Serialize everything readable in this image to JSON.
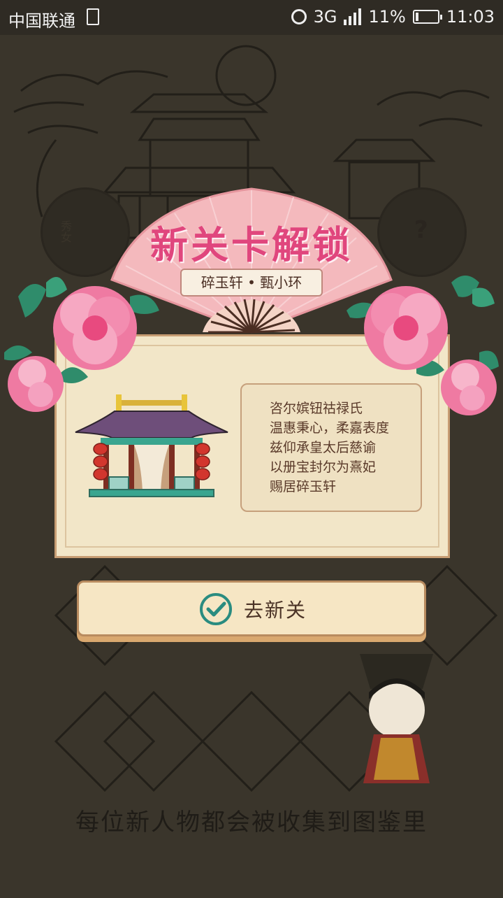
{
  "status_bar": {
    "carrier": "中国联通",
    "network": "3G",
    "battery": "11%",
    "time": "11:03"
  },
  "background": {
    "left_badge": "秀女",
    "right_badge": "?",
    "caption": "每位新人物都会被收集到图鉴里"
  },
  "popup": {
    "title": "新关卡解锁",
    "subtitle": "碎玉轩 • 甄小环",
    "decree_lines": [
      "咨尔嫔钮祜禄氏",
      "温惠秉心，柔嘉表度",
      "兹仰承皇太后慈谕",
      "以册宝封尔为熹妃",
      "赐居碎玉轩"
    ],
    "button_label": "去新关",
    "icons": {
      "palace": "palace-icon",
      "check": "check-circle-icon",
      "flower": "peony-flower-icon"
    },
    "colors": {
      "title_pink": "#e0467d",
      "card_bg": "#f2e6c8",
      "check_teal": "#2a8c80"
    }
  }
}
